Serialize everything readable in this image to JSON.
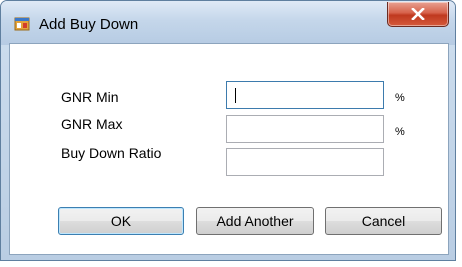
{
  "window": {
    "title": "Add Buy Down",
    "icons": {
      "app": "window-app-icon",
      "close": "close-icon"
    }
  },
  "form": {
    "fields": [
      {
        "label": "GNR Min",
        "value": "",
        "unit": "%"
      },
      {
        "label": "GNR Max",
        "value": "",
        "unit": "%"
      },
      {
        "label": "Buy Down Ratio",
        "value": ""
      }
    ]
  },
  "buttons": {
    "ok": "OK",
    "add_another": "Add Another",
    "cancel": "Cancel"
  }
}
